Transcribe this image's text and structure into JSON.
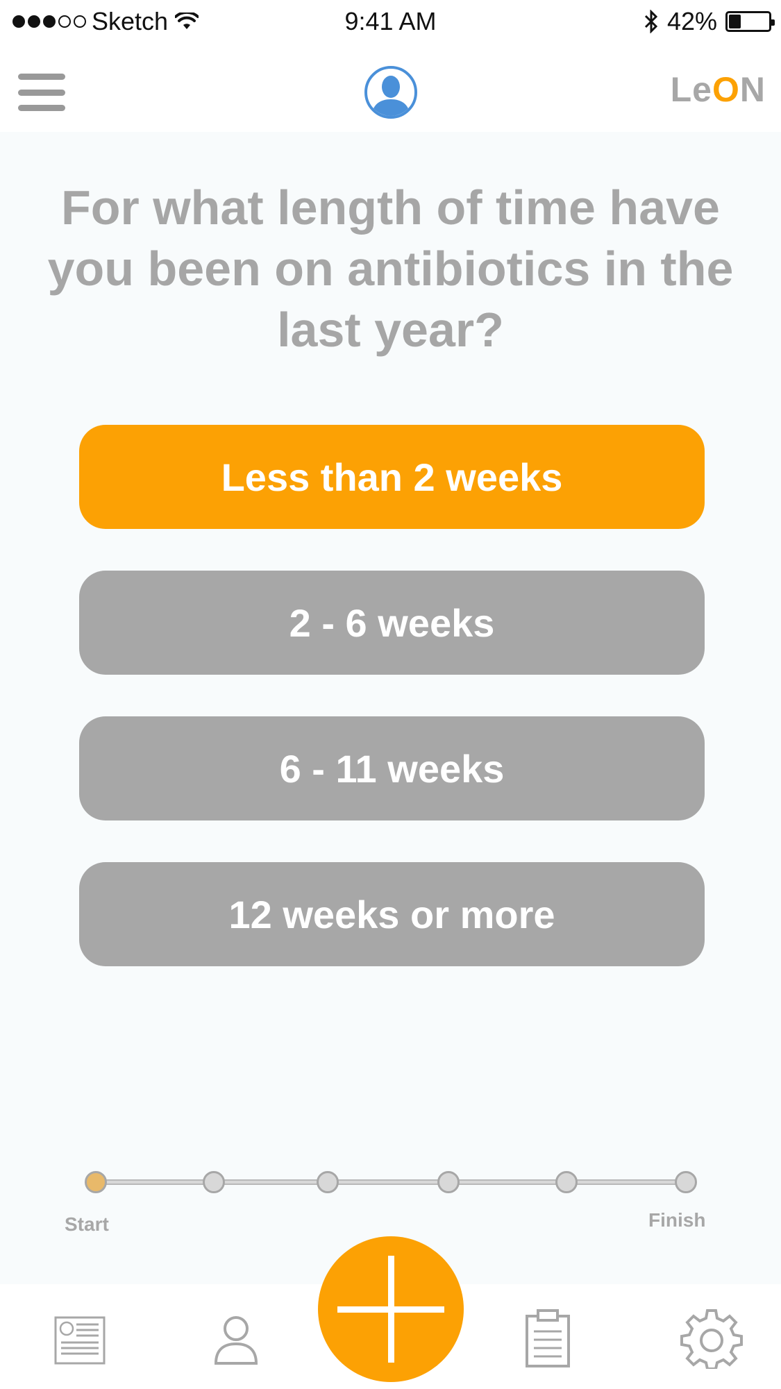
{
  "status_bar": {
    "carrier": "Sketch",
    "time": "9:41 AM",
    "battery_percent": "42%",
    "battery_level": 0.42,
    "signal_bars": 3,
    "signal_total": 5
  },
  "nav": {
    "logo_prefix": "Le",
    "logo_o": "O",
    "logo_suffix": "N",
    "menu_icon": "hamburger-menu-icon",
    "profile_icon": "user-avatar-icon"
  },
  "question": "For what length of time have you been on antibiotics in the last year?",
  "options": [
    {
      "label": "Less than 2 weeks",
      "selected": true
    },
    {
      "label": "2 - 6 weeks",
      "selected": false
    },
    {
      "label": "6 - 11 weeks",
      "selected": false
    },
    {
      "label": "12 weeks or more",
      "selected": false
    }
  ],
  "progress": {
    "start_label": "Start",
    "finish_label": "Finish",
    "total_steps": 6,
    "current_step": 1
  },
  "tab_bar": {
    "items": [
      "news-icon",
      "profile-icon",
      "add-icon",
      "clipboard-icon",
      "settings-icon"
    ]
  },
  "colors": {
    "accent": "#fca104",
    "inactive": "#a7a7a7",
    "text_gray": "#a6a6a6",
    "avatar_blue": "#4a90d9",
    "background": "#f8fbfc"
  }
}
